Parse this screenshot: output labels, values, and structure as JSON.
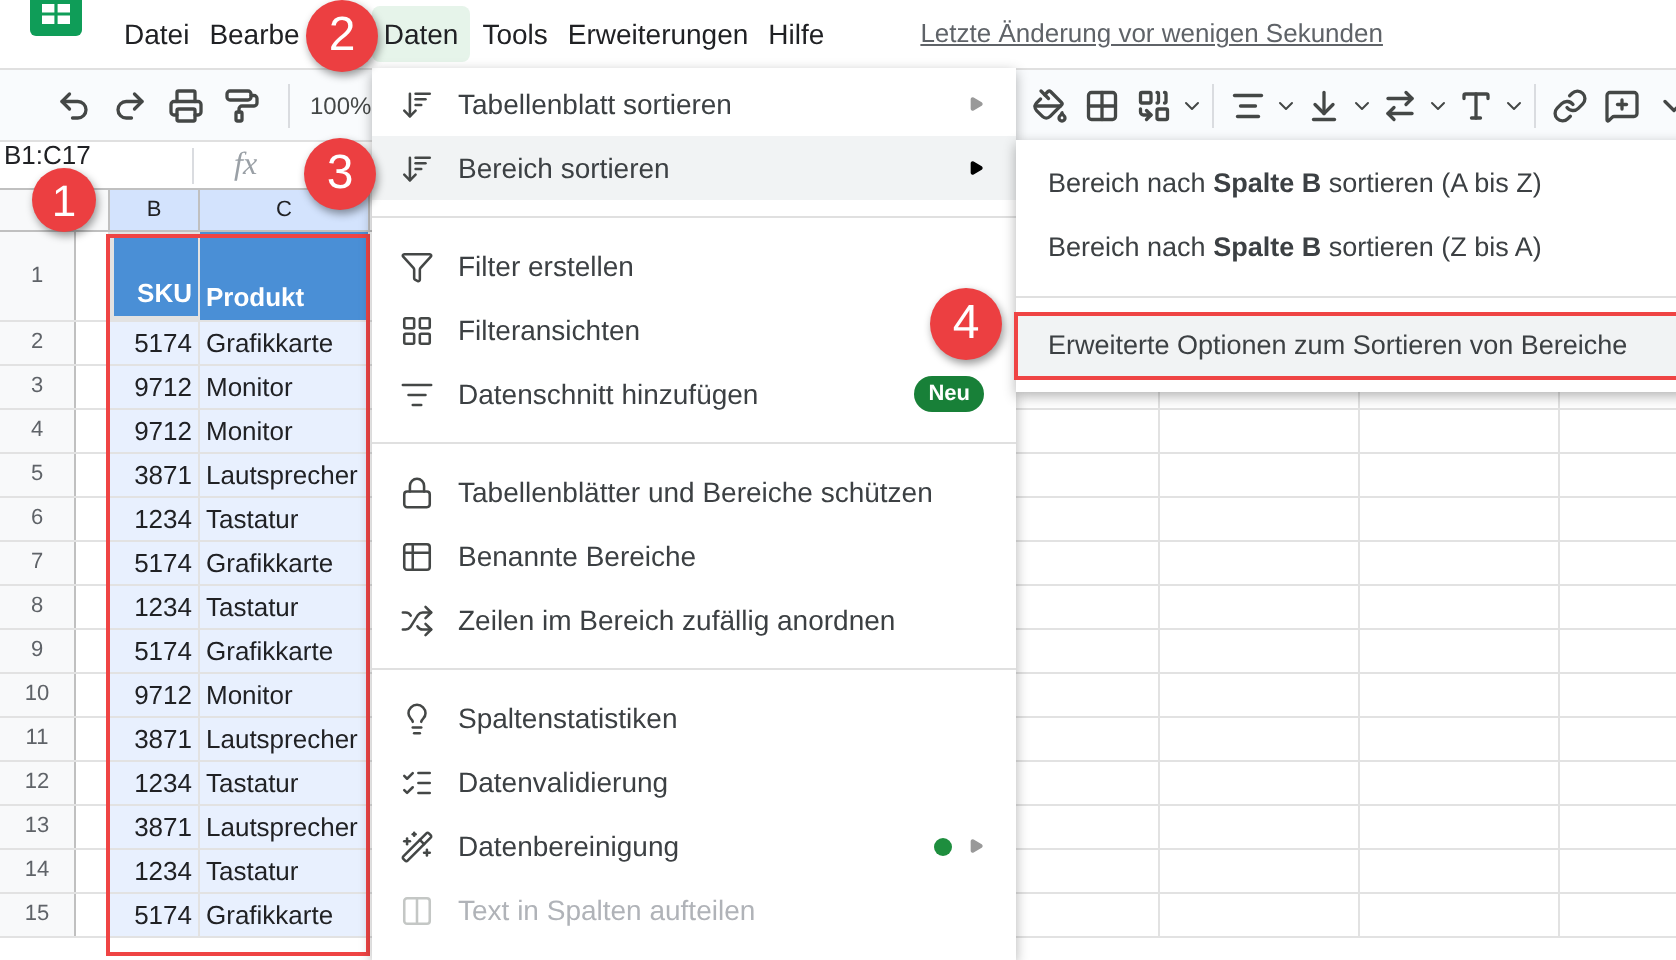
{
  "menu_bar": {
    "items": [
      {
        "label": "Datei",
        "selected": false
      },
      {
        "label": "Bearbe",
        "selected": false
      },
      {
        "label": "Daten",
        "selected": true
      },
      {
        "label": "Tools",
        "selected": false
      },
      {
        "label": "Erweiterungen",
        "selected": false
      },
      {
        "label": "Hilfe",
        "selected": false
      }
    ],
    "last_edit": "Letzte Änderung vor wenigen Sekunden"
  },
  "toolbar": {
    "zoom": "100%"
  },
  "formula_bar": {
    "name_box": "B1:C17",
    "function_label": "fx"
  },
  "sheet": {
    "columns": [
      "B",
      "C"
    ],
    "header_row": {
      "number": "1",
      "cells": [
        "SKU",
        "Produkt"
      ]
    },
    "rows": [
      {
        "number": "2",
        "cells": [
          "5174",
          "Grafikkarte"
        ]
      },
      {
        "number": "3",
        "cells": [
          "9712",
          "Monitor"
        ]
      },
      {
        "number": "4",
        "cells": [
          "9712",
          "Monitor"
        ]
      },
      {
        "number": "5",
        "cells": [
          "3871",
          "Lautsprecher"
        ]
      },
      {
        "number": "6",
        "cells": [
          "1234",
          "Tastatur"
        ]
      },
      {
        "number": "7",
        "cells": [
          "5174",
          "Grafikkarte"
        ]
      },
      {
        "number": "8",
        "cells": [
          "1234",
          "Tastatur"
        ]
      },
      {
        "number": "9",
        "cells": [
          "5174",
          "Grafikkarte"
        ]
      },
      {
        "number": "10",
        "cells": [
          "9712",
          "Monitor"
        ]
      },
      {
        "number": "11",
        "cells": [
          "3871",
          "Lautsprecher"
        ]
      },
      {
        "number": "12",
        "cells": [
          "1234",
          "Tastatur"
        ]
      },
      {
        "number": "13",
        "cells": [
          "3871",
          "Lautsprecher"
        ]
      },
      {
        "number": "14",
        "cells": [
          "1234",
          "Tastatur"
        ]
      },
      {
        "number": "15",
        "cells": [
          "5174",
          "Grafikkarte"
        ]
      }
    ]
  },
  "data_menu": {
    "groups": [
      [
        {
          "label": "Tabellenblatt sortieren",
          "submenu": true,
          "selected": false,
          "disabled": false
        },
        {
          "label": "Bereich sortieren",
          "submenu": true,
          "selected": true,
          "disabled": false
        }
      ],
      [
        {
          "label": "Filter erstellen",
          "submenu": false,
          "selected": false,
          "disabled": false
        },
        {
          "label": "Filteransichten",
          "submenu": false,
          "selected": false,
          "disabled": false
        },
        {
          "label": "Datenschnitt hinzufügen",
          "submenu": false,
          "selected": false,
          "disabled": false,
          "badge": "Neu"
        }
      ],
      [
        {
          "label": "Tabellenblätter und Bereiche schützen",
          "submenu": false,
          "selected": false,
          "disabled": false
        },
        {
          "label": "Benannte Bereiche",
          "submenu": false,
          "selected": false,
          "disabled": false
        },
        {
          "label": "Zeilen im Bereich zufällig anordnen",
          "submenu": false,
          "selected": false,
          "disabled": false
        }
      ],
      [
        {
          "label": "Spaltenstatistiken",
          "submenu": false,
          "selected": false,
          "disabled": false
        },
        {
          "label": "Datenvalidierung",
          "submenu": false,
          "selected": false,
          "disabled": false
        },
        {
          "label": "Datenbereinigung",
          "submenu": true,
          "selected": false,
          "disabled": false,
          "color": "#1e8e3e"
        },
        {
          "label": "Text in Spalten aufteilen",
          "submenu": false,
          "selected": false,
          "disabled": true
        }
      ]
    ]
  },
  "sort_submenu": {
    "groups": [
      [
        {
          "label": "Bereich nach **Spalte B** sortieren (A bis Z)",
          "selected": false
        },
        {
          "label": "Bereich nach **Spalte B** sortieren (Z bis A)",
          "selected": false
        }
      ],
      [
        {
          "label": "Erweiterte Optionen zum Sortieren von Bereiche",
          "selected": true
        }
      ]
    ]
  },
  "callouts": [
    "1",
    "2",
    "3",
    "4"
  ]
}
